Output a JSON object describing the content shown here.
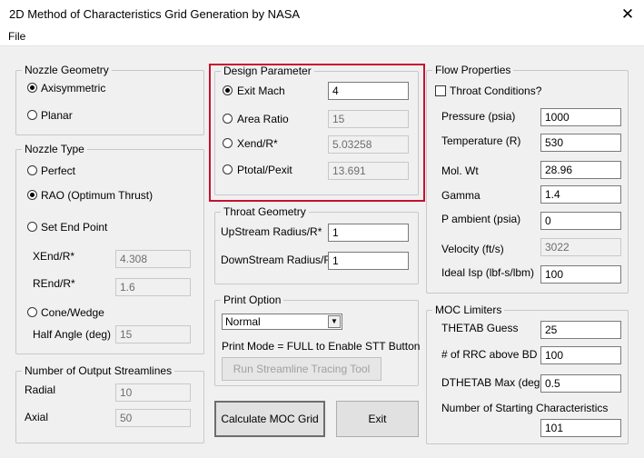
{
  "window": {
    "title": "2D Method of Characteristics Grid Generation by NASA",
    "close_glyph": "✕"
  },
  "menu": {
    "file": "File"
  },
  "nozzle_geometry": {
    "title": "Nozzle Geometry",
    "options": [
      {
        "label": "Axisymmetric",
        "selected": true
      },
      {
        "label": "Planar",
        "selected": false
      }
    ]
  },
  "nozzle_type": {
    "title": "Nozzle Type",
    "perfect": {
      "label": "Perfect",
      "selected": false
    },
    "rao": {
      "label": "RAO (Optimum Thrust)",
      "selected": true
    },
    "end_point": {
      "label": "Set End Point",
      "selected": false
    },
    "xend_label": "XEnd/R*",
    "xend_value": "4.308",
    "rend_label": "REnd/R*",
    "rend_value": "1.6",
    "cone": {
      "label": "Cone/Wedge",
      "selected": false
    },
    "half_angle_label": "Half Angle (deg)",
    "half_angle_value": "15"
  },
  "output_streamlines": {
    "title": "Number of Output Streamlines",
    "radial_label": "Radial",
    "radial_value": "10",
    "axial_label": "Axial",
    "axial_value": "50"
  },
  "design_parameter": {
    "title": "Design Parameter",
    "rows": [
      {
        "label": "Exit Mach",
        "value": "4",
        "selected": true
      },
      {
        "label": "Area Ratio",
        "value": "15",
        "selected": false
      },
      {
        "label": "Xend/R*",
        "value": "5.03258",
        "selected": false
      },
      {
        "label": "Ptotal/Pexit",
        "value": "13.691",
        "selected": false
      }
    ]
  },
  "throat_geometry": {
    "title": "Throat Geometry",
    "upstream_label": "UpStream Radius/R*",
    "upstream_value": "1",
    "downstream_label": "DownStream Radius/R*",
    "downstream_value": "1"
  },
  "print_option": {
    "title": "Print Option",
    "selected": "Normal",
    "note": "Print Mode = FULL to Enable STT Button",
    "stt_button": "Run Streamline Tracing Tool"
  },
  "buttons": {
    "calculate": "Calculate MOC Grid",
    "exit": "Exit"
  },
  "flow_properties": {
    "title": "Flow Properties",
    "throat_label": "Throat Conditions?",
    "rows": [
      {
        "label": "Pressure (psia)",
        "value": "1000",
        "enabled": true
      },
      {
        "label": "Temperature (R)",
        "value": "530",
        "enabled": true
      },
      {
        "label": "Mol. Wt",
        "value": "28.96",
        "enabled": true
      },
      {
        "label": "Gamma",
        "value": "1.4",
        "enabled": true
      },
      {
        "label": "P ambient (psia)",
        "value": "0",
        "enabled": true
      },
      {
        "label": "Velocity (ft/s)",
        "value": "3022",
        "enabled": false
      },
      {
        "label": "Ideal Isp (lbf-s/lbm)",
        "value": "100",
        "enabled": true
      }
    ]
  },
  "moc_limiters": {
    "title": "MOC Limiters",
    "thetab_label": "THETAB Guess",
    "thetab_value": "25",
    "rrc_label": "# of RRC above BD",
    "rrc_value": "100",
    "dthetab_label": "DTHETAB Max (deg)",
    "dthetab_value": "0.5",
    "nsc_label": "Number of Starting Characteristics",
    "nsc_value": "101"
  },
  "colors": {
    "highlight": "#c8102e",
    "background": "#f0f0f0"
  }
}
